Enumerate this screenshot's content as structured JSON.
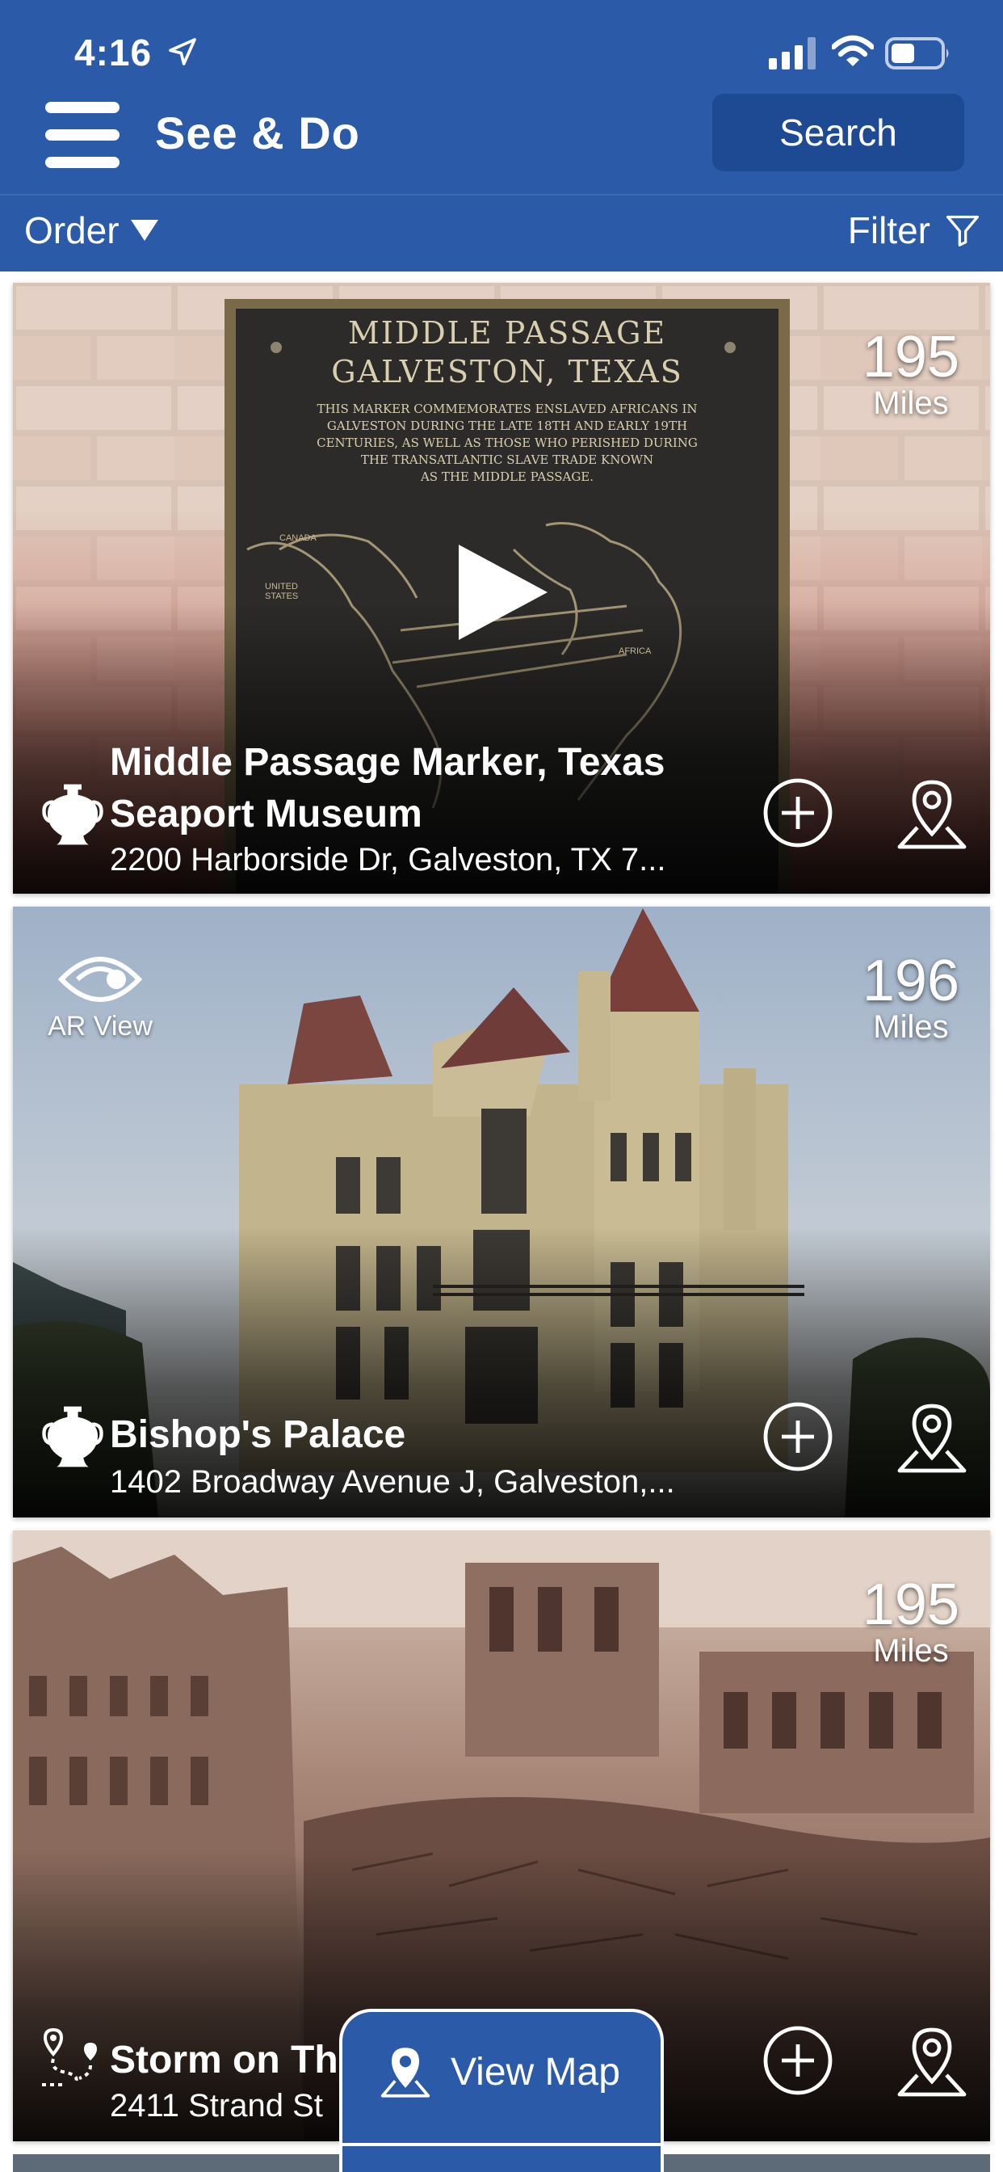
{
  "status_bar": {
    "time": "4:16"
  },
  "header": {
    "title": "See & Do",
    "search_label": "Search"
  },
  "toolbar": {
    "order_label": "Order",
    "filter_label": "Filter"
  },
  "cards": [
    {
      "title": "Middle Passage Marker, Texas Seaport Museum",
      "address": "2200 Harborside Dr, Galveston, TX 7...",
      "distance": "195",
      "distance_unit": "Miles",
      "has_video": true,
      "plaque": {
        "heading1": "MIDDLE PASSAGE",
        "heading2": "GALVESTON, TEXAS",
        "text": [
          "THIS MARKER COMMEMORATES ENSLAVED AFRICANS IN",
          "GALVESTON DURING THE LATE 18TH AND EARLY 19TH",
          "CENTURIES, AS WELL AS THOSE WHO PERISHED DURING",
          "THE TRANSATLANTIC SLAVE TRADE KNOWN",
          "AS THE MIDDLE PASSAGE."
        ],
        "map_labels": [
          "CANADA",
          "UNITED STATES",
          "AFRICA"
        ]
      }
    },
    {
      "title": "Bishop's Palace",
      "address": "1402 Broadway Avenue J, Galveston,...",
      "distance": "196",
      "distance_unit": "Miles",
      "ar_label": "AR View"
    },
    {
      "title": "Storm on Th",
      "address": "2411 Strand St",
      "distance": "195",
      "distance_unit": "Miles"
    }
  ],
  "view_map_label": "View Map",
  "colors": {
    "brand_blue": "#2a5aa8",
    "button_blue": "#1d4a93"
  },
  "icons": [
    "location-arrow-icon",
    "signal-icon",
    "wifi-icon",
    "battery-icon",
    "menu-icon",
    "filter-icon",
    "amphora-icon",
    "add-circle-icon",
    "map-pin-icon",
    "ar-eye-icon",
    "tour-route-icon",
    "play-icon"
  ]
}
